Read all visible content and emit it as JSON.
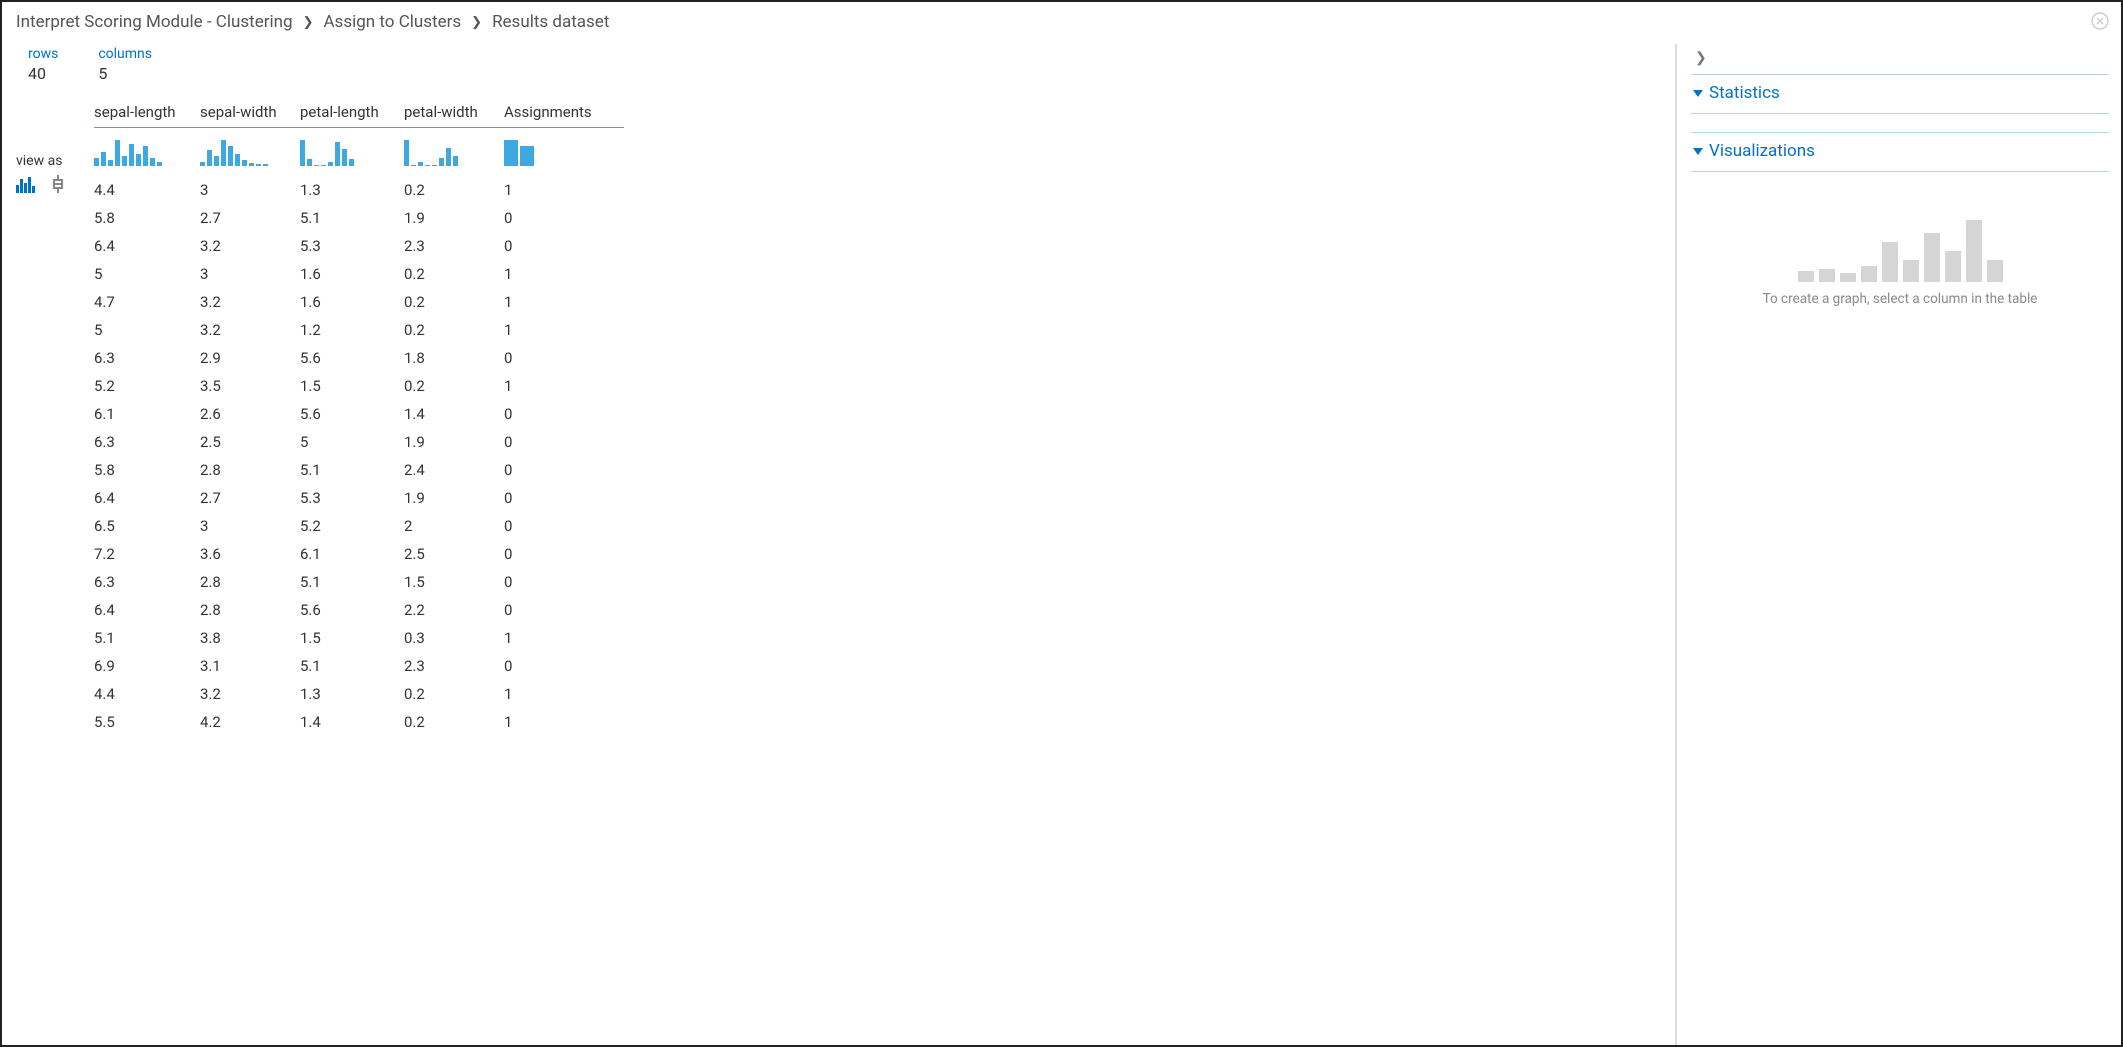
{
  "breadcrumb": {
    "items": [
      "Interpret Scoring Module - Clustering",
      "Assign to Clusters",
      "Results dataset"
    ]
  },
  "meta": {
    "rows_label": "rows",
    "rows_value": "40",
    "columns_label": "columns",
    "columns_value": "5"
  },
  "view_as_label": "view as",
  "columns": [
    "sepal-length",
    "sepal-width",
    "petal-length",
    "petal-width",
    "Assignments"
  ],
  "rows": [
    [
      "4.4",
      "3",
      "1.3",
      "0.2",
      "1"
    ],
    [
      "5.8",
      "2.7",
      "5.1",
      "1.9",
      "0"
    ],
    [
      "6.4",
      "3.2",
      "5.3",
      "2.3",
      "0"
    ],
    [
      "5",
      "3",
      "1.6",
      "0.2",
      "1"
    ],
    [
      "4.7",
      "3.2",
      "1.6",
      "0.2",
      "1"
    ],
    [
      "5",
      "3.2",
      "1.2",
      "0.2",
      "1"
    ],
    [
      "6.3",
      "2.9",
      "5.6",
      "1.8",
      "0"
    ],
    [
      "5.2",
      "3.5",
      "1.5",
      "0.2",
      "1"
    ],
    [
      "6.1",
      "2.6",
      "5.6",
      "1.4",
      "0"
    ],
    [
      "6.3",
      "2.5",
      "5",
      "1.9",
      "0"
    ],
    [
      "5.8",
      "2.8",
      "5.1",
      "2.4",
      "0"
    ],
    [
      "6.4",
      "2.7",
      "5.3",
      "1.9",
      "0"
    ],
    [
      "6.5",
      "3",
      "5.2",
      "2",
      "0"
    ],
    [
      "7.2",
      "3.6",
      "6.1",
      "2.5",
      "0"
    ],
    [
      "6.3",
      "2.8",
      "5.1",
      "1.5",
      "0"
    ],
    [
      "6.4",
      "2.8",
      "5.6",
      "2.2",
      "0"
    ],
    [
      "5.1",
      "3.8",
      "1.5",
      "0.3",
      "1"
    ],
    [
      "6.9",
      "3.1",
      "5.1",
      "2.3",
      "0"
    ],
    [
      "4.4",
      "3.2",
      "1.3",
      "0.2",
      "1"
    ],
    [
      "5.5",
      "4.2",
      "1.4",
      "0.2",
      "1"
    ]
  ],
  "histograms": {
    "sepal-length": [
      8,
      14,
      6,
      26,
      10,
      22,
      12,
      20,
      8,
      4
    ],
    "sepal-width": [
      4,
      16,
      10,
      26,
      20,
      12,
      6,
      3,
      2,
      2
    ],
    "petal-length": [
      24,
      6,
      0,
      0,
      4,
      22,
      16,
      6
    ],
    "petal-width": [
      26,
      0,
      4,
      0,
      0,
      8,
      18,
      10
    ],
    "Assignments": [
      26,
      20
    ]
  },
  "right": {
    "statistics_label": "Statistics",
    "visualizations_label": "Visualizations",
    "viz_hint": "To create a graph, select a column in the table"
  },
  "ghost_chart_heights": [
    10,
    12,
    8,
    14,
    36,
    20,
    44,
    28,
    56,
    20
  ]
}
